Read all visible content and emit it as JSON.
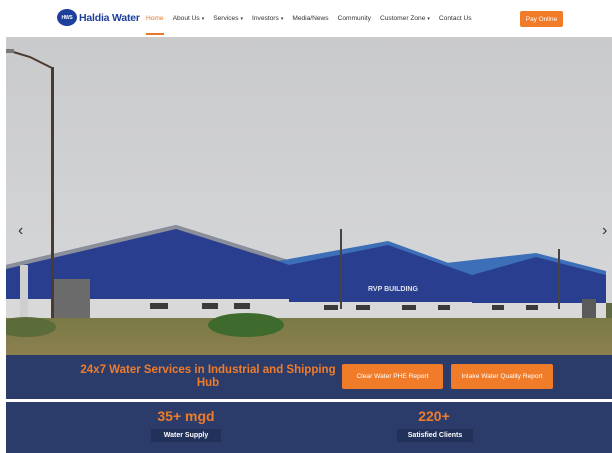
{
  "brand": {
    "logo_mark": "HWS",
    "name": "Haldia Water"
  },
  "nav": {
    "items": [
      {
        "label": "Home",
        "has_caret": false,
        "active": true
      },
      {
        "label": "About Us",
        "has_caret": true,
        "active": false
      },
      {
        "label": "Services",
        "has_caret": true,
        "active": false
      },
      {
        "label": "Investors",
        "has_caret": true,
        "active": false
      },
      {
        "label": "Media/News",
        "has_caret": false,
        "active": false
      },
      {
        "label": "Community",
        "has_caret": false,
        "active": false
      },
      {
        "label": "Customer Zone",
        "has_caret": true,
        "active": false
      },
      {
        "label": "Contact Us",
        "has_caret": false,
        "active": false
      }
    ],
    "caret_glyph": "▾",
    "pay_button": "Pay Online"
  },
  "hero": {
    "building_sign": "RVP BUILDING",
    "prev_arrow": "‹",
    "next_arrow": "›"
  },
  "banner": {
    "title": "24x7 Water Services in Industrial and Shipping Hub",
    "buttons": [
      "Clear Water PHE Report",
      "Intake Water Quality Report"
    ]
  },
  "stats": [
    {
      "value": "35+ mgd",
      "label": "Water Supply"
    },
    {
      "value": "220+",
      "label": "Satisfied Clients"
    }
  ],
  "colors": {
    "accent": "#f07c2a",
    "brand_blue": "#1f3f9c",
    "banner_bg": "#2b3c6b"
  }
}
